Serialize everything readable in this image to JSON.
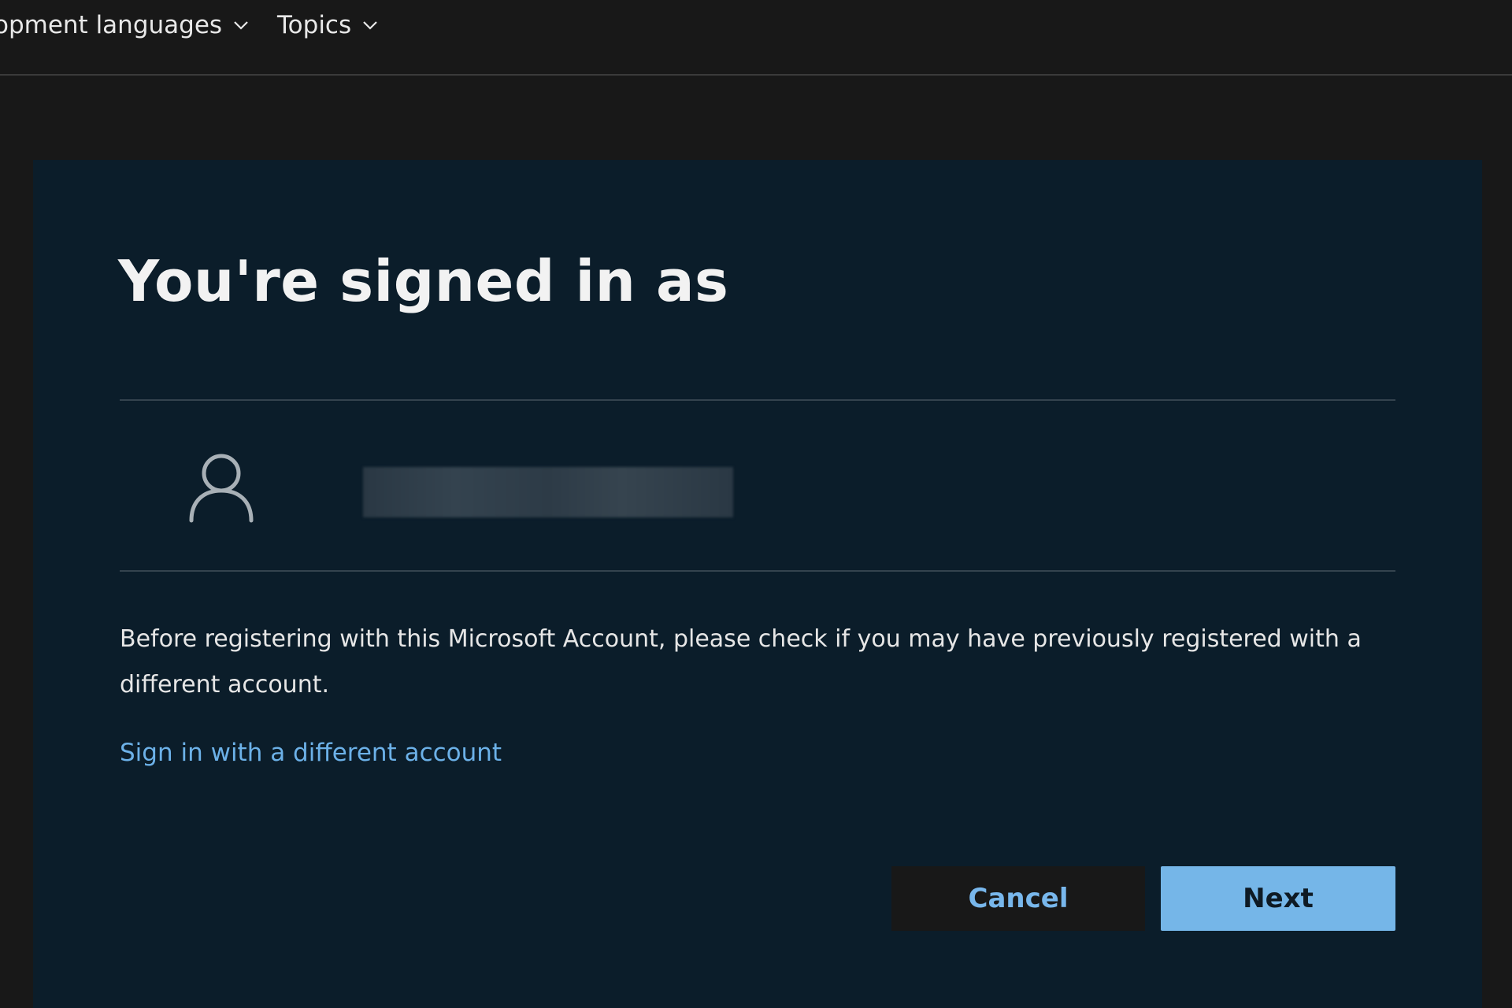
{
  "topnav": {
    "items": [
      {
        "label": "opment languages",
        "icon": "chevron-down-icon"
      },
      {
        "label": "Topics",
        "icon": "chevron-down-icon"
      }
    ]
  },
  "dialog": {
    "title": "You're signed in as",
    "account_icon": "user-icon",
    "notice": "Before registering with this Microsoft Account, please check if you may have previously registered with a different account.",
    "alt_link": "Sign in with a different account",
    "cancel_label": "Cancel",
    "next_label": "Next"
  },
  "colors": {
    "page_bg": "#181818",
    "panel_bg": "#0b1d2a",
    "link": "#6cb1e8",
    "primary_button": "#75b6e8"
  }
}
